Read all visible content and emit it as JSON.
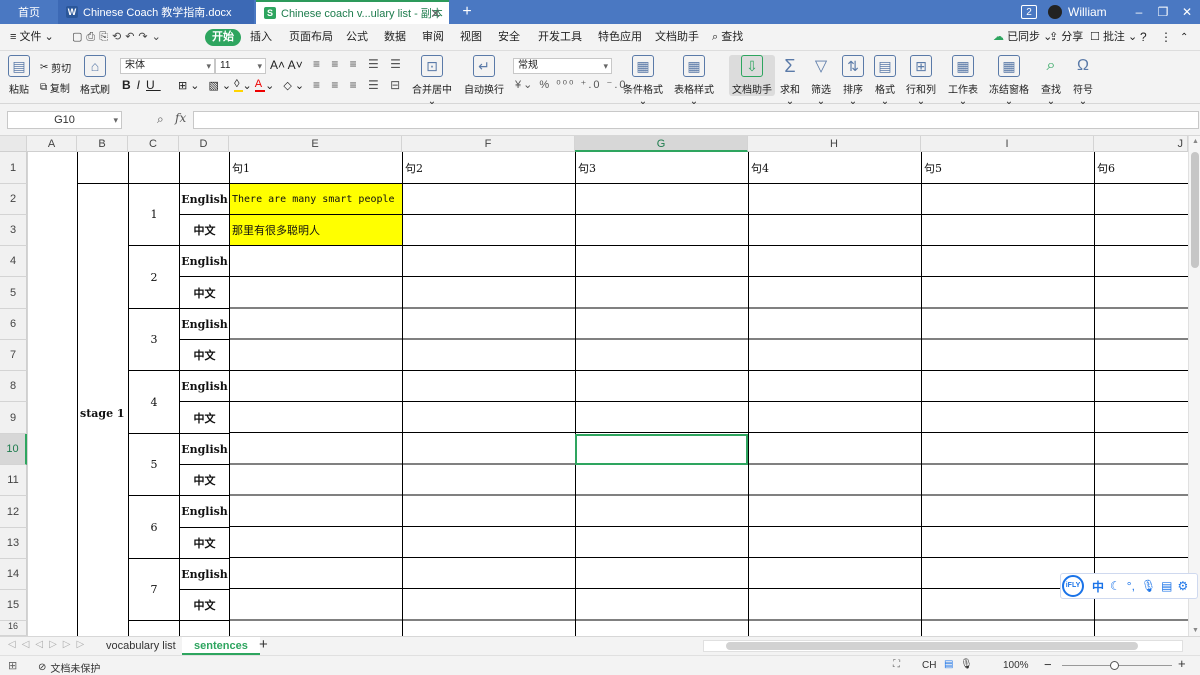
{
  "titlebar": {
    "tabs": [
      {
        "label": "首页"
      },
      {
        "label": "Chinese Coach 教学指南.docx",
        "icon": "W"
      },
      {
        "label": "Chinese coach v...ulary list - 副本",
        "icon": "S"
      }
    ],
    "badge": "2",
    "user": "William"
  },
  "menubar": {
    "file": "文件",
    "items": [
      "开始",
      "插入",
      "页面布局",
      "公式",
      "数据",
      "审阅",
      "视图",
      "安全",
      "开发工具",
      "特色应用",
      "文档助手"
    ],
    "search": "查找",
    "sync": "已同步",
    "share": "分享",
    "comment": "批注"
  },
  "ribbon": {
    "cut": "剪切",
    "paste": "粘贴",
    "copy": "复制",
    "format_painter": "格式刷",
    "font": "宋体",
    "size": "11",
    "merge": "合并居中",
    "wrap": "自动换行",
    "number_format": "常规",
    "cond_format": "条件格式",
    "table_style": "表格样式",
    "doc_helper": "文档助手",
    "sum": "求和",
    "filter": "筛选",
    "sort": "排序",
    "format": "格式",
    "rowcol": "行和列",
    "sheet": "工作表",
    "freeze": "冻结窗格",
    "find": "查找",
    "symbol": "符号"
  },
  "formula_bar": {
    "name_box": "G10",
    "fx": "fx",
    "value": ""
  },
  "columns": [
    "A",
    "B",
    "C",
    "D",
    "E",
    "F",
    "G",
    "H",
    "I",
    "J"
  ],
  "rows": [
    "1",
    "2",
    "3",
    "4",
    "5",
    "6",
    "7",
    "8",
    "9",
    "10",
    "11",
    "12",
    "13",
    "14",
    "15",
    "16"
  ],
  "sheet": {
    "headers": [
      "句1",
      "句2",
      "句3",
      "句4",
      "句5",
      "句6"
    ],
    "stage": "stage 1",
    "groups": [
      "1",
      "2",
      "3",
      "4",
      "5",
      "6",
      "7"
    ],
    "lang_en": "English",
    "lang_zh": "中文",
    "e2": "There are many smart people",
    "e3": "那里有很多聪明人"
  },
  "sheet_tabs": [
    "vocabulary list",
    "sentences"
  ],
  "statusbar": {
    "protect": "文档未保护",
    "ime": "CH",
    "zoom": "100%"
  },
  "ifly": {
    "brand": "iFLY",
    "mode": "中"
  }
}
